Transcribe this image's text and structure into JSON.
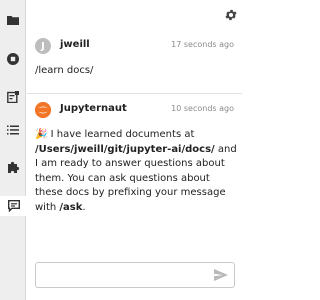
{
  "sidebar": {
    "items": [
      {
        "icon": "folder-icon"
      },
      {
        "icon": "stop-circle-icon"
      },
      {
        "icon": "running-terminals-icon"
      },
      {
        "icon": "table-of-contents-icon"
      },
      {
        "icon": "extension-puzzle-icon"
      },
      {
        "icon": "chat-icon",
        "active": true
      }
    ]
  },
  "chat": {
    "settings_icon": "gear-icon",
    "messages": [
      {
        "avatar_letter": "J",
        "author": "jweill",
        "time": "17 seconds ago",
        "text": "/learn docs/"
      },
      {
        "avatar_icon": "jupyter-logo-icon",
        "author": "Jupyternaut",
        "time": "10 seconds ago",
        "emoji": "🎉",
        "text_1": " I have learned documents at ",
        "path": "/Users/jweill/git/jupyter-ai/docs/",
        "text_2": " and I am ready to answer questions about them. You can ask questions about these docs by prefixing your message with ",
        "command": "/ask",
        "text_3": "."
      }
    ],
    "input": {
      "value": "",
      "placeholder": ""
    },
    "send_icon": "send-icon"
  },
  "colors": {
    "sidebar_bg": "#eeeeee",
    "icon": "#333333",
    "bot_avatar": "#f37626",
    "user_avatar": "#bdbdbd",
    "send_icon": "#b8b8b8"
  }
}
